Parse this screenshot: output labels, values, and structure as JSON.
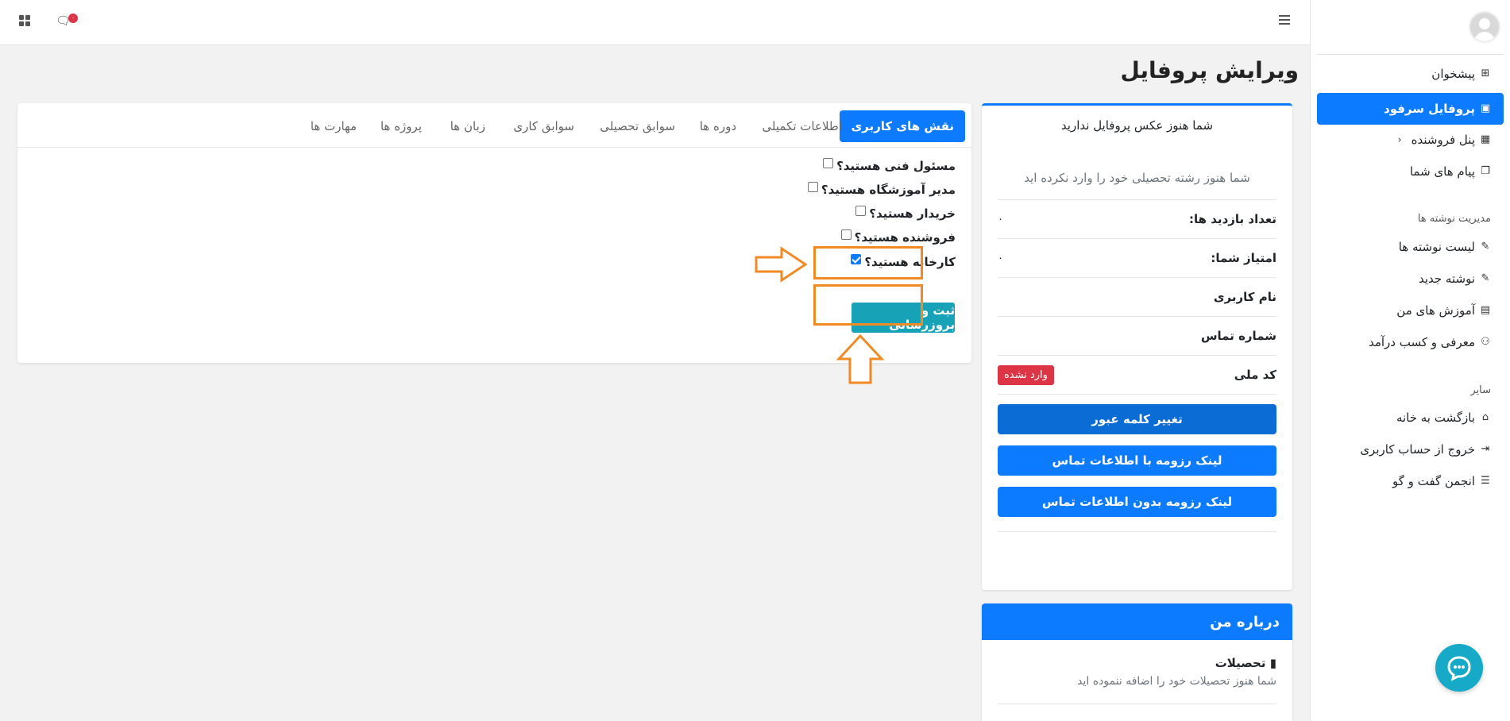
{
  "topbar": {
    "chat_badge_count": "۰"
  },
  "sidebar": {
    "items": [
      {
        "label": "پیشخوان",
        "icon": "dashboard-icon"
      },
      {
        "label": "پروفایل سرفود",
        "icon": "profile-card-icon",
        "active": true
      },
      {
        "label": "پنل فروشنده",
        "icon": "store-icon",
        "has_submenu": true
      },
      {
        "label": "پیام های شما",
        "icon": "messages-icon"
      }
    ],
    "section_posts": "مدیریت نوشته ها",
    "post_items": [
      {
        "label": "لیست نوشته ها",
        "icon": "edit-icon"
      },
      {
        "label": "نوشته جدید",
        "icon": "edit-icon"
      },
      {
        "label": "آموزش های من",
        "icon": "book-icon"
      },
      {
        "label": "معرفی و کسب درآمد",
        "icon": "users-icon"
      }
    ],
    "section_other": "سایر",
    "other_items": [
      {
        "label": "بازگشت به خانه",
        "icon": "home-icon"
      },
      {
        "label": "خروج از حساب کاربری",
        "icon": "logout-icon"
      },
      {
        "label": "انجمن گفت و گو",
        "icon": "forum-icon"
      }
    ]
  },
  "page": {
    "title": "ویرایش پروفایل"
  },
  "profile_card": {
    "no_photo": "شما هنوز عکس پروفایل ندارید",
    "no_field": "شما هنوز رشته تحصیلی خود را وارد نکرده اید",
    "visits_label": "تعداد بازدید ها:",
    "visits_value": "۰",
    "score_label": "امتیاز شما:",
    "score_value": "۰",
    "username_label": "نام کاربری",
    "phone_label": "شماره تماس",
    "national_id_label": "کد ملی",
    "national_id_badge": "وارد نشده",
    "change_password": "تغییر کلمه عبور",
    "resume_with_contact": "لینک رزومه با اطلاعات تماس",
    "resume_without_contact": "لینک رزومه بدون اطلاعات تماس"
  },
  "about_card": {
    "title": "درباره من",
    "education_title": "تحصیلات",
    "education_empty": "شما هنوز تحصیلات خود را اضافه ننموده اید"
  },
  "tabs": [
    {
      "label": "نقش های کاربری",
      "active": true
    },
    {
      "label": "اطلاعات تکمیلی"
    },
    {
      "label": "دوره ها"
    },
    {
      "label": "سوابق تحصیلی"
    },
    {
      "label": "سوابق کاری"
    },
    {
      "label": "زبان ها"
    },
    {
      "label": "پروژه ها"
    },
    {
      "label": "مهارت ها"
    }
  ],
  "roles": [
    {
      "label": "مسئول فنی هستید؟",
      "checked": false
    },
    {
      "label": "مدیر آموزشگاه هستید؟",
      "checked": false
    },
    {
      "label": "خریدار هستید؟",
      "checked": false
    },
    {
      "label": "فروشنده هستید؟",
      "checked": false
    },
    {
      "label": "کارخانه هستید؟",
      "checked": true
    }
  ],
  "submit_label": "ثبت و بروزرسانی",
  "colors": {
    "primary": "#0d7bff",
    "submit": "#17a2b8",
    "danger": "#dc3545",
    "annotation": "#f08a24"
  }
}
